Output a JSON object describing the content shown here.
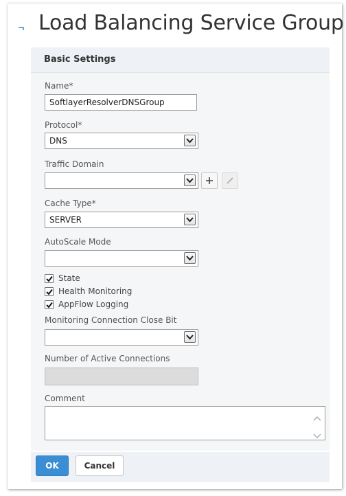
{
  "page": {
    "title": "Load Balancing Service Group"
  },
  "section": {
    "title": "Basic Settings"
  },
  "fields": {
    "name": {
      "label": "Name*",
      "value": "SoftlayerResolverDNSGroup"
    },
    "protocol": {
      "label": "Protocol*",
      "value": "DNS"
    },
    "traffic_domain": {
      "label": "Traffic Domain",
      "value": ""
    },
    "cache_type": {
      "label": "Cache Type*",
      "value": "SERVER"
    },
    "autoscale_mode": {
      "label": "AutoScale Mode",
      "value": ""
    },
    "monitoring_close_bit": {
      "label": "Monitoring Connection Close Bit",
      "value": ""
    },
    "active_connections": {
      "label": "Number of Active Connections",
      "value": ""
    },
    "comment": {
      "label": "Comment",
      "value": ""
    }
  },
  "checkboxes": [
    {
      "label": "State",
      "checked": true
    },
    {
      "label": "Health Monitoring",
      "checked": true
    },
    {
      "label": "AppFlow Logging",
      "checked": true
    }
  ],
  "buttons": {
    "ok": "OK",
    "cancel": "Cancel"
  },
  "colors": {
    "primary_button": "#3b8dd4",
    "panel_header": "#eef1f5",
    "panel_body": "#f5f6f8"
  }
}
